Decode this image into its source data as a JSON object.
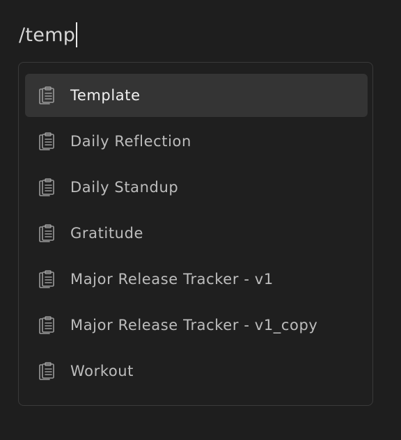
{
  "command": {
    "query": "/temp"
  },
  "menu": {
    "items": [
      {
        "label": "Template",
        "icon": "template-icon",
        "selected": true
      },
      {
        "label": "Daily Reflection",
        "icon": "template-icon",
        "selected": false
      },
      {
        "label": "Daily Standup",
        "icon": "template-icon",
        "selected": false
      },
      {
        "label": "Gratitude",
        "icon": "template-icon",
        "selected": false
      },
      {
        "label": "Major Release Tracker - v1",
        "icon": "template-icon",
        "selected": false
      },
      {
        "label": "Major Release Tracker - v1_copy",
        "icon": "template-icon",
        "selected": false
      },
      {
        "label": "Workout",
        "icon": "template-icon",
        "selected": false
      }
    ]
  },
  "colors": {
    "background": "#1e1e1e",
    "menu_border": "#3a3a3a",
    "selected_background": "#343434",
    "text": "#bdbdbd",
    "selected_text": "#f2f2f2"
  }
}
